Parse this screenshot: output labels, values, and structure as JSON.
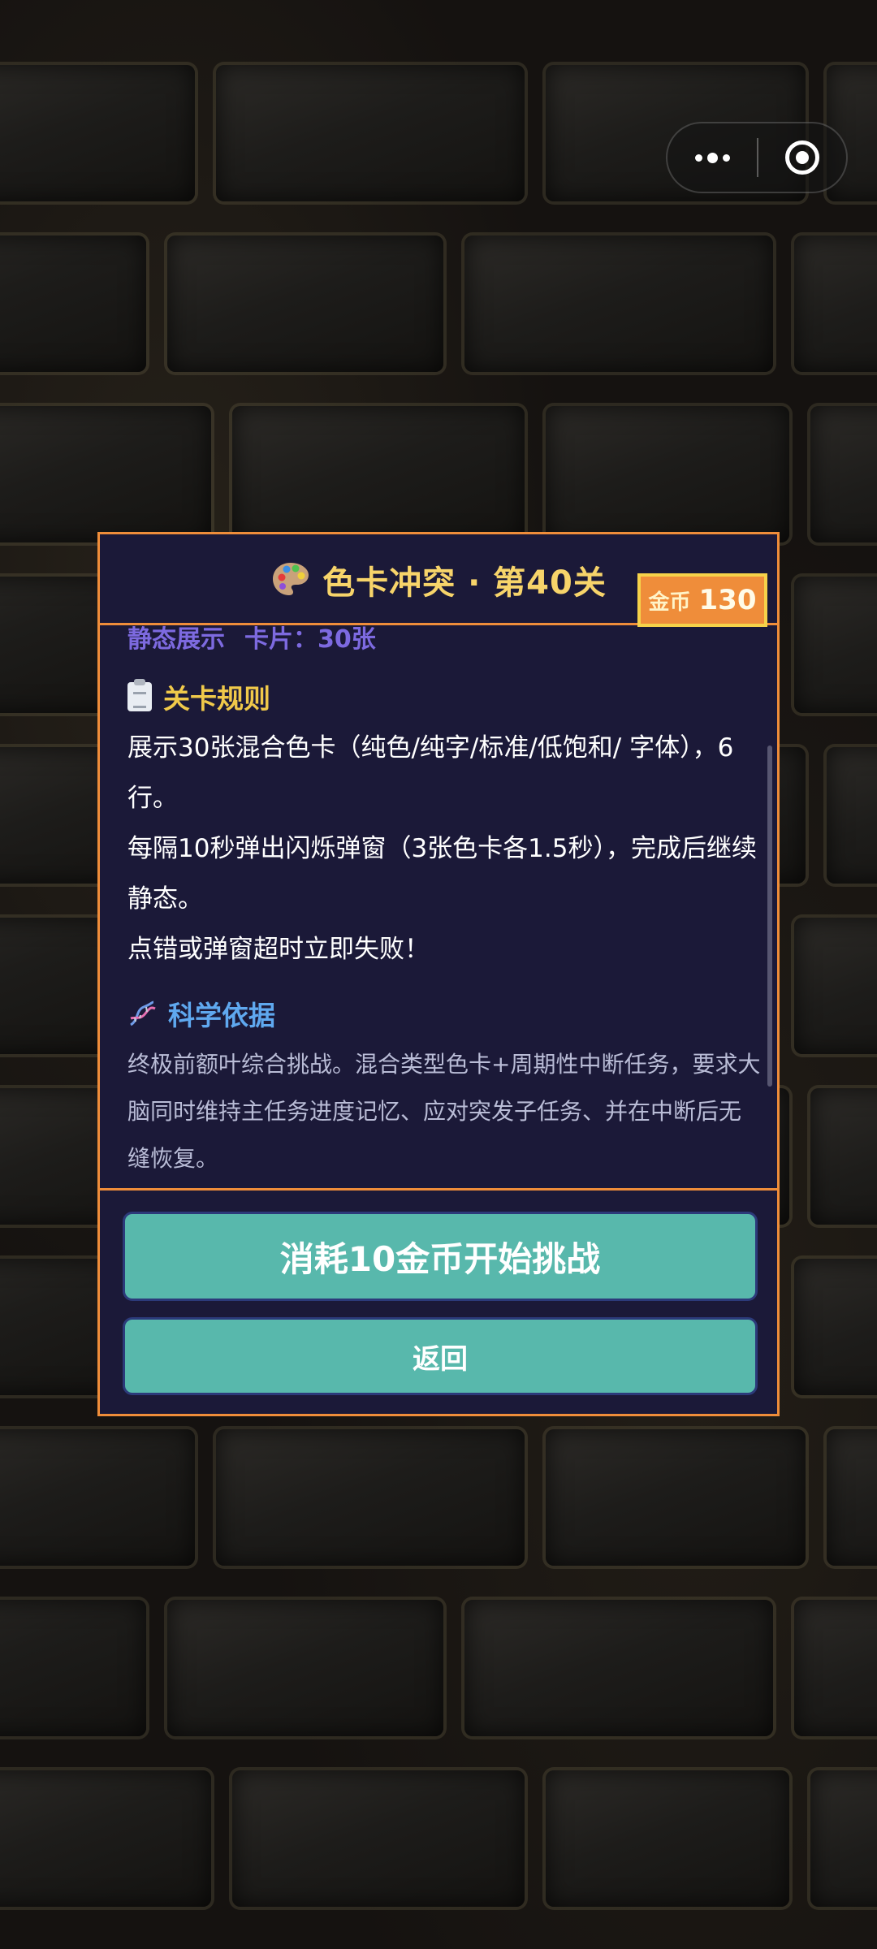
{
  "capsule": {
    "more_icon": "more-dots-icon",
    "close_icon": "target-close-icon"
  },
  "dialog": {
    "title_icon": "palette-icon",
    "title": "色卡冲突 · 第40关",
    "coins": {
      "label": "金币",
      "value": "130"
    },
    "meta": {
      "mode": "静态展示",
      "cards": "卡片：30张"
    },
    "rules": {
      "icon": "clipboard-icon",
      "heading": "关卡规则",
      "lines": [
        "展示30张混合色卡（纯色/纯字/标准/低饱和/ 字体），6行。",
        "每隔10秒弹出闪烁弹窗（3张色卡各1.5秒），完成后继续静态。",
        "点错或弹窗超时立即失败！"
      ]
    },
    "science": {
      "icon": "dna-icon",
      "heading": "科学依据",
      "text": "终极前额叶综合挑战。混合类型色卡+周期性中断任务，要求大脑同时维持主任务进度记忆、应对突发子任务、并在中断后无缝恢复。"
    },
    "buttons": {
      "start": "消耗10金币开始挑战",
      "back": "返回"
    }
  },
  "colors": {
    "panel_bg": "#1b1938",
    "border_accent": "#ef8d3a",
    "title_gold": "#f7d46a",
    "button_teal": "#58b8ac",
    "meta_purple": "#7d6ae0",
    "science_blue": "#5fa8ef"
  }
}
